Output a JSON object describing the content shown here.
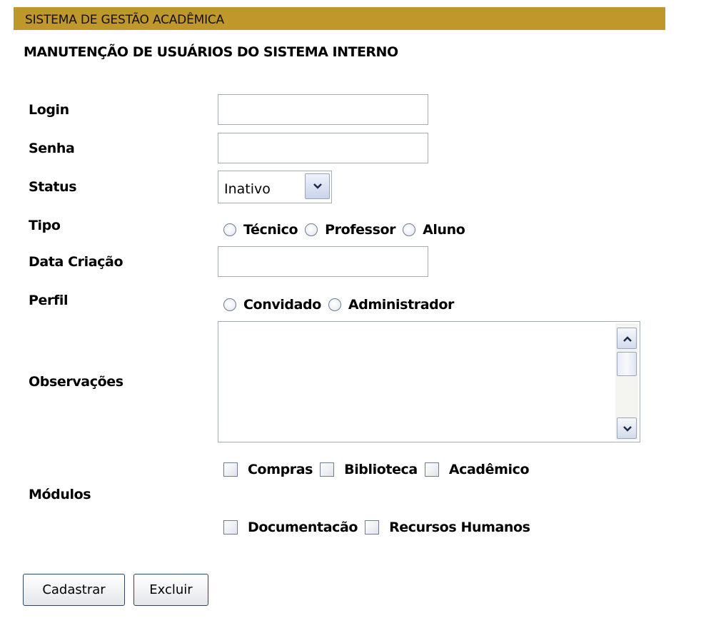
{
  "header": {
    "app_title": "SISTEMA DE GESTÃO ACADÊMICA"
  },
  "page": {
    "title": "MANUTENÇÃO DE USUÁRIOS DO SISTEMA INTERNO"
  },
  "form": {
    "login": {
      "label": "Login",
      "value": ""
    },
    "senha": {
      "label": "Senha",
      "value": ""
    },
    "status": {
      "label": "Status",
      "selected": "Inativo"
    },
    "tipo": {
      "label": "Tipo",
      "options": [
        "Técnico",
        "Professor",
        "Aluno"
      ]
    },
    "data_criacao": {
      "label": "Data Criação",
      "value": ""
    },
    "perfil": {
      "label": "Perfil",
      "options": [
        "Convidado",
        "Administrador"
      ]
    },
    "observacoes": {
      "label": "Observações",
      "value": ""
    },
    "modulos": {
      "label": "Módulos",
      "row1": [
        "Compras",
        "Biblioteca",
        "Acadêmico"
      ],
      "row2": [
        "Documentacão",
        "Recursos Humanos"
      ]
    }
  },
  "actions": {
    "cadastrar": "Cadastrar",
    "excluir": "Excluir"
  },
  "colors": {
    "header_bar": "#c0972a",
    "input_border": "#a5acb5",
    "button_border": "#2f4660"
  },
  "icons": {
    "select_arrow": "chevron-down-icon",
    "scroll_up": "chevron-up-icon",
    "scroll_down": "chevron-down-icon"
  }
}
